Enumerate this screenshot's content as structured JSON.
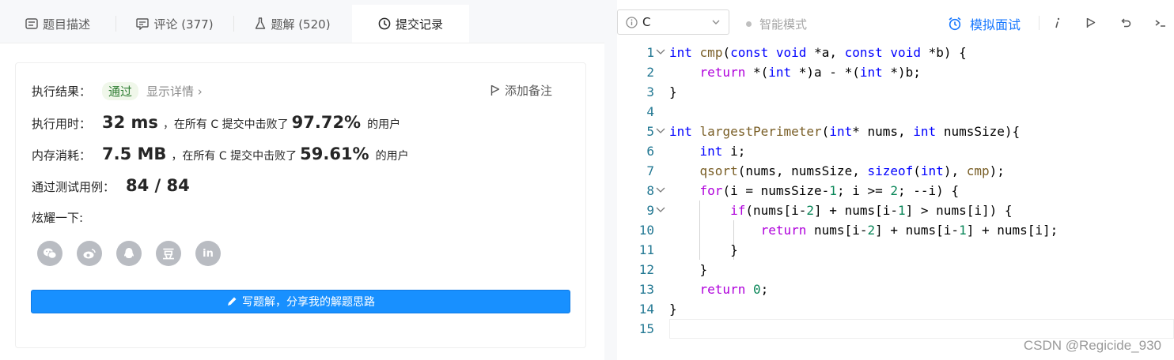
{
  "tabs": [
    {
      "label": "题目描述",
      "icon": "description-icon"
    },
    {
      "label": "评论 (377)",
      "icon": "comment-icon"
    },
    {
      "label": "题解 (520)",
      "icon": "flask-icon"
    },
    {
      "label": "提交记录",
      "icon": "clock-icon"
    }
  ],
  "active_tab": "提交记录",
  "result": {
    "label": "执行结果：",
    "status": "通过",
    "detail_link": "显示详情 ›",
    "add_note": "添加备注",
    "runtime_label": "执行用时：",
    "runtime_value": "32 ms",
    "runtime_text": "，在所有 C 提交中击败了",
    "runtime_percent": "97.72%",
    "runtime_suffix": "的用户",
    "memory_label": "内存消耗：",
    "memory_value": "7.5 MB",
    "memory_text": "，在所有 C 提交中击败了",
    "memory_percent": "59.61%",
    "memory_suffix": "的用户",
    "tests_label": "通过测试用例：",
    "tests_value": "84 / 84",
    "share_label": "炫耀一下:",
    "share_icons": [
      "wechat-icon",
      "weibo-icon",
      "qq-icon",
      "douban-icon",
      "linkedin-icon"
    ],
    "douban_glyph": "豆",
    "linkedin_glyph": "in",
    "write_solution": "写题解，分享我的解题思路"
  },
  "toolbar": {
    "language": "C",
    "smart_mode": "智能模式",
    "mock_interview": "模拟面试"
  },
  "code_lines": [
    {
      "n": "1",
      "fold": true
    },
    {
      "n": "2"
    },
    {
      "n": "3"
    },
    {
      "n": "4"
    },
    {
      "n": "5",
      "fold": true
    },
    {
      "n": "6"
    },
    {
      "n": "7"
    },
    {
      "n": "8",
      "fold": true
    },
    {
      "n": "9",
      "fold": true
    },
    {
      "n": "10"
    },
    {
      "n": "11"
    },
    {
      "n": "12"
    },
    {
      "n": "13"
    },
    {
      "n": "14"
    },
    {
      "n": "15"
    }
  ],
  "code_text": [
    "int cmp(const void *a, const void *b) {",
    "    return *(int *)a - *(int *)b;",
    "}",
    "",
    "int largestPerimeter(int* nums, int numsSize){",
    "    int i;",
    "    qsort(nums, numsSize, sizeof(int), cmp);",
    "    for(i = numsSize-1; i >= 2; --i) {",
    "        if(nums[i-2] + nums[i-1] > nums[i]) {",
    "            return nums[i-2] + nums[i-1] + nums[i];",
    "        }",
    "    }",
    "    return 0;",
    "}",
    ""
  ],
  "watermark": "CSDN @Regicide_930",
  "colors": {
    "accent": "#1890ff",
    "pass_bg": "#f0f7ea",
    "pass_text": "#2e7d32",
    "line_number": "#237893"
  }
}
